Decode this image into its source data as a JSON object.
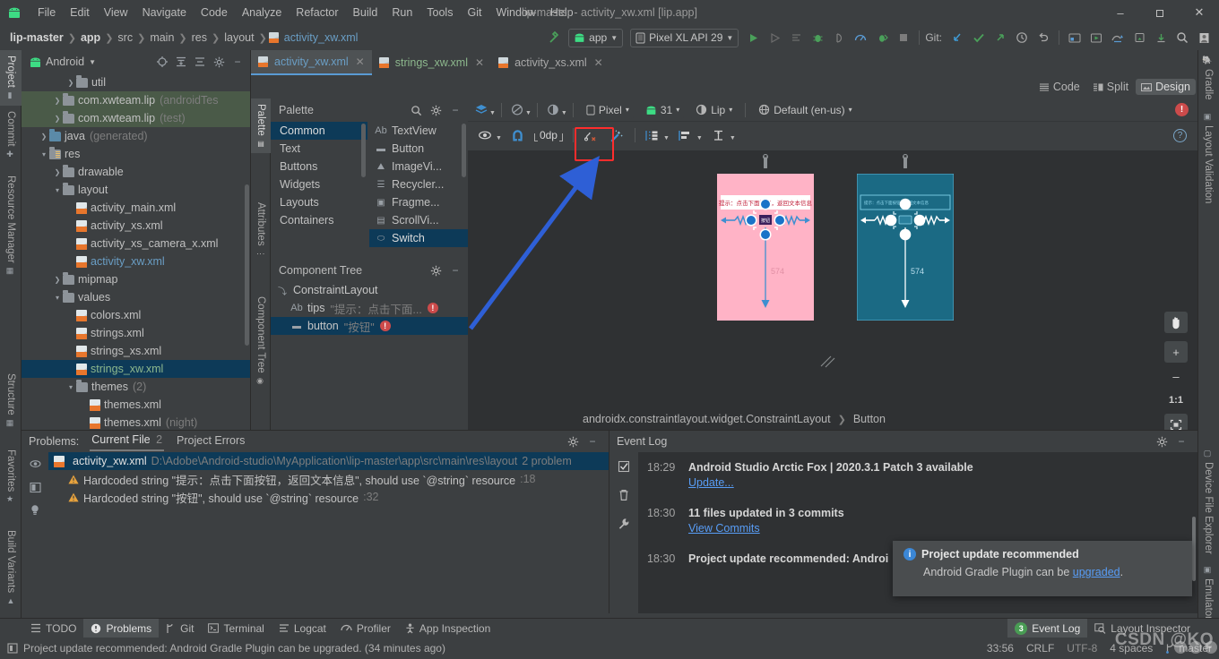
{
  "titlebar": {
    "menus": [
      "File",
      "Edit",
      "View",
      "Navigate",
      "Code",
      "Analyze",
      "Refactor",
      "Build",
      "Run",
      "Tools",
      "Git",
      "Window",
      "Help"
    ],
    "window_title": "lip-master - activity_xw.xml [lip.app]",
    "minimize": "–",
    "maximize": "❐",
    "close": "✕"
  },
  "navbar": {
    "breadcrumbs": [
      "lip-master",
      "app",
      "src",
      "main",
      "res",
      "layout",
      "activity_xw.xml"
    ],
    "run_config": "app",
    "device": "Pixel XL API 29",
    "git_label": "Git:",
    "icons": {
      "build": "build-hammer-icon",
      "run": "run-icon",
      "apply_changes": "apply-changes-icon",
      "debug": "debug-icon",
      "profile": "profiler-icon",
      "stop": "stop-icon",
      "update_project": "git-pull-icon",
      "commit": "git-commit-icon",
      "push": "git-push-icon",
      "history": "history-icon",
      "undo": "undo-icon",
      "search": "search-icon",
      "avatar": "user-avatar-icon"
    }
  },
  "left_tool_tabs": [
    "Project",
    "Commit",
    "Resource Manager",
    "Structure",
    "Favorites",
    "Build Variants"
  ],
  "right_tool_tabs": [
    "Gradle",
    "Layout Validation",
    "Device File Explorer",
    "Emulator"
  ],
  "project": {
    "title": "Android",
    "tree": [
      {
        "label": "util",
        "type": "folder",
        "indent": 3,
        "arrow": true,
        "state": "normal"
      },
      {
        "label": "com.xwteam.lip",
        "suffix": "(androidTes",
        "type": "folder",
        "indent": 2,
        "arrow": true,
        "state": "green"
      },
      {
        "label": "com.xwteam.lip",
        "suffix": "(test)",
        "type": "folder",
        "indent": 2,
        "arrow": true,
        "state": "green"
      },
      {
        "label": "java",
        "suffix": "(generated)",
        "type": "folder-java",
        "indent": 1,
        "arrow": true,
        "state": "normal"
      },
      {
        "label": "res",
        "type": "folder-res",
        "indent": 1,
        "arrow": "open",
        "state": "normal"
      },
      {
        "label": "drawable",
        "type": "folder",
        "indent": 2,
        "arrow": true,
        "state": "normal"
      },
      {
        "label": "layout",
        "type": "folder",
        "indent": 2,
        "arrow": "open",
        "state": "normal"
      },
      {
        "label": "activity_main.xml",
        "type": "xml",
        "indent": 3,
        "state": "normal"
      },
      {
        "label": "activity_xs.xml",
        "type": "xml",
        "indent": 3,
        "state": "normal"
      },
      {
        "label": "activity_xs_camera_x.xml",
        "type": "xml",
        "indent": 3,
        "state": "normal"
      },
      {
        "label": "activity_xw.xml",
        "type": "xml",
        "indent": 3,
        "state": "link"
      },
      {
        "label": "mipmap",
        "type": "folder",
        "indent": 2,
        "arrow": true,
        "state": "normal"
      },
      {
        "label": "values",
        "type": "folder",
        "indent": 2,
        "arrow": "open",
        "state": "normal"
      },
      {
        "label": "colors.xml",
        "type": "xml",
        "indent": 3,
        "state": "normal"
      },
      {
        "label": "strings.xml",
        "type": "xml",
        "indent": 3,
        "state": "normal"
      },
      {
        "label": "strings_xs.xml",
        "type": "xml",
        "indent": 3,
        "state": "normal"
      },
      {
        "label": "strings_xw.xml",
        "type": "xml",
        "indent": 3,
        "state": "selected"
      },
      {
        "label": "themes",
        "suffix": "(2)",
        "type": "folder",
        "indent": 3,
        "arrow": "open",
        "state": "normal"
      },
      {
        "label": "themes.xml",
        "type": "xml",
        "indent": 4,
        "state": "normal"
      },
      {
        "label": "themes.xml",
        "suffix": "(night)",
        "type": "xml",
        "indent": 4,
        "state": "normal"
      }
    ]
  },
  "editor_tabs": [
    {
      "label": "activity_xw.xml",
      "active": true
    },
    {
      "label": "strings_xw.xml",
      "active": false
    },
    {
      "label": "activity_xs.xml",
      "active": false
    }
  ],
  "view_modes": [
    {
      "label": "Code",
      "active": false,
      "icon": "code-lines-icon"
    },
    {
      "label": "Split",
      "active": false,
      "icon": "split-view-icon"
    },
    {
      "label": "Design",
      "active": true,
      "icon": "design-view-icon"
    }
  ],
  "palette": {
    "title": "Palette",
    "categories": [
      "Common",
      "Text",
      "Buttons",
      "Widgets",
      "Layouts",
      "Containers"
    ],
    "selected_category": "Common",
    "items": [
      {
        "label": "TextView",
        "icon": "Ab"
      },
      {
        "label": "Button",
        "icon": "button-icon"
      },
      {
        "label": "ImageVi...",
        "icon": "image-icon"
      },
      {
        "label": "Recycler...",
        "icon": "list-icon"
      },
      {
        "label": "Fragme...",
        "icon": "fragment-icon"
      },
      {
        "label": "ScrollVi...",
        "icon": "scroll-icon"
      },
      {
        "label": "Switch",
        "icon": "switch-icon"
      }
    ],
    "selected_item": "Switch"
  },
  "component_tree": {
    "title": "Component Tree",
    "nodes": [
      {
        "label": "ConstraintLayout",
        "value": "",
        "icon": "constraint-layout-icon",
        "indent": 0,
        "error": false,
        "selected": false
      },
      {
        "label": "tips",
        "value": "\"提示：点击下面...",
        "icon": "Ab",
        "indent": 1,
        "error": true,
        "selected": false
      },
      {
        "label": "button",
        "value": "\"按钮\"",
        "icon": "button-icon",
        "indent": 1,
        "error": true,
        "selected": true
      }
    ]
  },
  "design_toolbar": {
    "row1": {
      "design_mode": "design-surface-icon",
      "blueprint_mode": "blueprint-icon",
      "orientation": "orientation-icon",
      "device": "Pixel",
      "api_level": "31",
      "theme": "Lip",
      "locale": "Default (en-us)",
      "warning_count": "!"
    },
    "row2": {
      "view_options": "eye-icon",
      "autoconnect": "magnet-icon",
      "default_margin": "0dp",
      "clear_constraints": "clear-constraints-icon",
      "infer_constraints": "magic-wand-icon",
      "guidelines": "guidelines-icon",
      "align": "align-icon",
      "margin_tool": "margin-icon",
      "help": "?"
    }
  },
  "design_canvas": {
    "render_label": "574",
    "blueprint_label": "574",
    "zoom_controls": {
      "pan": "pan-hand-icon",
      "zoom_in": "+",
      "zoom_out": "–",
      "zoom_actual": "1:1",
      "zoom_fit": "fit-screen-icon"
    },
    "device_render_text": "提示：点击下面按钮，返回文本信息",
    "button_text": "按钮"
  },
  "design_breadcrumb": {
    "parent": "androidx.constraintlayout.widget.ConstraintLayout",
    "child": "Button"
  },
  "problems": {
    "label": "Problems:",
    "tabs": [
      {
        "label": "Current File",
        "count": "2",
        "active": true
      },
      {
        "label": "Project Errors",
        "count": "",
        "active": false
      }
    ],
    "file_row": {
      "name": "activity_xw.xml",
      "path": "D:\\Adobe\\Android-studio\\MyApplication\\lip-master\\app\\src\\main\\res\\layout",
      "count": "2 problem"
    },
    "items": [
      {
        "text": "Hardcoded string \"提示：点击下面按钮，返回文本信息\", should use `@string` resource",
        "line": ":18"
      },
      {
        "text": "Hardcoded string \"按钮\", should use `@string` resource",
        "line": ":32"
      }
    ]
  },
  "event_log": {
    "title": "Event Log",
    "entries": [
      {
        "time": "18:29",
        "message": "Android Studio Arctic Fox | 2020.3.1 Patch 3 available",
        "link": "Update..."
      },
      {
        "time": "18:30",
        "message": "11 files updated in 3 commits",
        "link": "View Commits"
      },
      {
        "time": "18:30",
        "message": "Project update recommended: Androi",
        "link": ""
      }
    ]
  },
  "toast": {
    "title": "Project update recommended",
    "body_prefix": "Android Gradle Plugin can be ",
    "body_link": "upgraded",
    "body_suffix": "."
  },
  "bottom_tools": [
    {
      "label": "TODO",
      "icon": "todo-icon",
      "active": false
    },
    {
      "label": "Problems",
      "icon": "problems-icon",
      "active": true
    },
    {
      "label": "Git",
      "icon": "git-icon",
      "active": false
    },
    {
      "label": "Terminal",
      "icon": "terminal-icon",
      "active": false
    },
    {
      "label": "Logcat",
      "icon": "logcat-icon",
      "active": false
    },
    {
      "label": "Profiler",
      "icon": "profiler-icon",
      "active": false
    },
    {
      "label": "App Inspection",
      "icon": "app-inspection-icon",
      "active": false
    }
  ],
  "bottom_tools_right": [
    {
      "label": "Event Log",
      "badge": "3",
      "active": true
    },
    {
      "label": "Layout Inspector",
      "badge": "",
      "active": false
    }
  ],
  "statusbar": {
    "message": "Project update recommended: Android Gradle Plugin can be upgraded. (34 minutes ago)",
    "caret": "33:56",
    "line_sep": "CRLF",
    "encoding": "UTF-8",
    "indent": "4 spaces",
    "branch": "master"
  },
  "watermark": "CSDN @KQ",
  "colors": {
    "accent_blue": "#589df6",
    "link_blue": "#6a9ec5",
    "error_red": "#cc4b4b",
    "warn_yellow": "#e8a33d",
    "green": "#499c54",
    "render_pink": "#ffb3c6",
    "blueprint_teal": "#1b6a84",
    "selection_blue": "#0d3a58"
  }
}
